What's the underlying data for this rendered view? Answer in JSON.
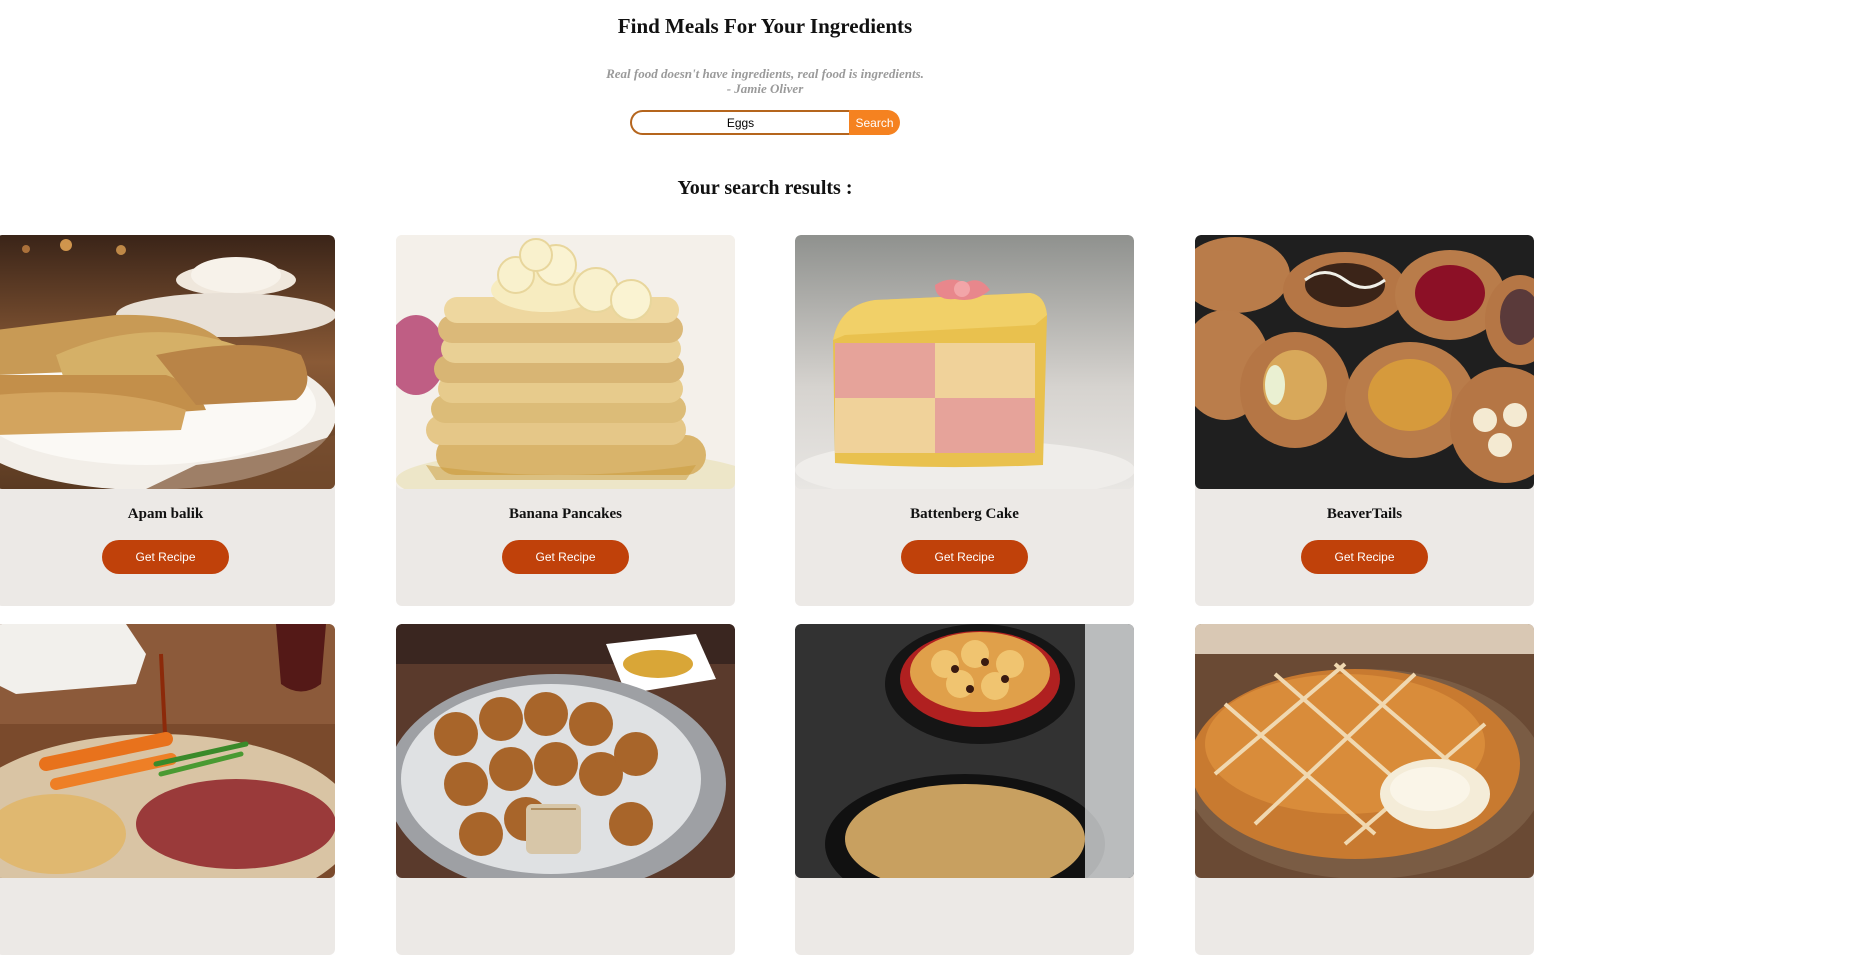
{
  "header": {
    "title": "Find Meals For Your Ingredients",
    "quote_line1": "Real food doesn't have ingredients, real food is ingredients.",
    "quote_line2": "- Jamie Oliver"
  },
  "search": {
    "value": "Eggs",
    "button_label": "Search"
  },
  "results": {
    "heading": "Your search results :",
    "button_label": "Get Recipe",
    "meals": [
      {
        "name": "Apam balik"
      },
      {
        "name": "Banana Pancakes"
      },
      {
        "name": "Battenberg Cake"
      },
      {
        "name": "BeaverTails"
      },
      {
        "name": ""
      },
      {
        "name": ""
      },
      {
        "name": ""
      },
      {
        "name": ""
      }
    ]
  },
  "colors": {
    "accent": "#f58220",
    "recipe_button": "#c0410a",
    "card_bg": "#ece9e6",
    "quote_text": "#9a9a9a"
  }
}
